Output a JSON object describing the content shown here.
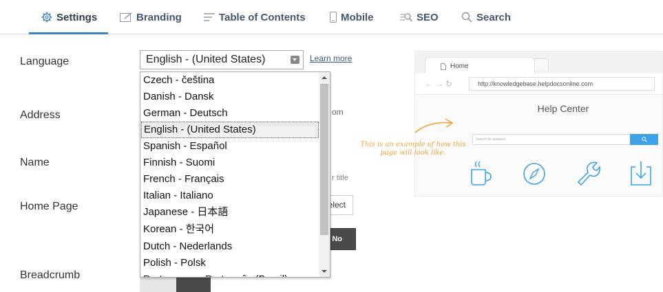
{
  "tabs": [
    {
      "label": "Settings",
      "icon": "gear-icon",
      "active": true
    },
    {
      "label": "Branding",
      "icon": "edit-icon"
    },
    {
      "label": "Table of Contents",
      "icon": "list-icon"
    },
    {
      "label": "Mobile",
      "icon": "mobile-icon"
    },
    {
      "label": "SEO",
      "icon": "seo-icon"
    },
    {
      "label": "Search",
      "icon": "search-icon"
    }
  ],
  "form": {
    "language_label": "Language",
    "address_label": "Address",
    "name_label": "Name",
    "homepage_label": "Home Page",
    "breadcrumb_label": "Breadcrumb",
    "language_value": "English - (United States)",
    "learn_more": "Learn more",
    "address_partial": "om",
    "name_partial": "r title",
    "select_button": "elect",
    "no_button": "No"
  },
  "dropdown": {
    "options": [
      "Czech - čeština",
      "Danish - Dansk",
      "German - Deutsch",
      "English - (United States)",
      "Spanish - Español",
      "Finnish - Suomi",
      "French - Français",
      "Italian - Italiano",
      "Japanese - 日本語",
      "Korean - 한국어",
      "Dutch - Nederlands",
      "Polish - Polsk",
      "Portuguese - Português (Brasil)"
    ],
    "selected_index": 3
  },
  "preview": {
    "tab_label": "Home",
    "url": "http://knowledgebase.helpdocsonline.com",
    "title": "Help Center",
    "search_placeholder": "Search for answers",
    "note": "This is an example of how this page will look like.",
    "accent_color": "#3da2e8",
    "note_color": "#f0a43a"
  }
}
